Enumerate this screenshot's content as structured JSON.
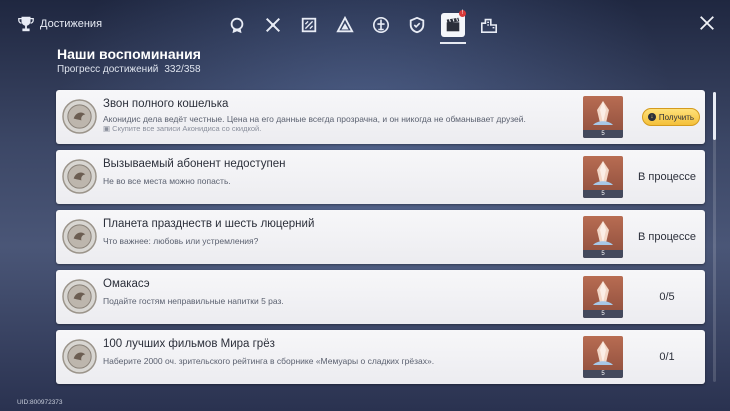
{
  "header": {
    "title": "Достижения",
    "tabs": [
      {
        "icon": "badge-icon"
      },
      {
        "icon": "crossed-swords-icon"
      },
      {
        "icon": "patterned-square-icon"
      },
      {
        "icon": "triangle-emblem-icon"
      },
      {
        "icon": "fountain-emblem-icon"
      },
      {
        "icon": "shield-icon"
      },
      {
        "icon": "film-clapper-icon",
        "active": true,
        "notification": "!"
      },
      {
        "icon": "city-icon"
      }
    ]
  },
  "section": {
    "title": "Наши воспоминания",
    "progress_label": "Прогресс достижений",
    "progress_value": "332/358"
  },
  "achievements": [
    {
      "title": "Звон полного кошелька",
      "description": "Аконидис дела ведёт честные. Цена на его данные всегда прозрачна, и он никогда не обманывает друзей.",
      "hint": "Скупите все записи Аконидиса со скидкой.",
      "reward_count": "5",
      "status": "",
      "claim_label": "Получить"
    },
    {
      "title": "Вызываемый абонент недоступен",
      "description": "Не во все места можно попасть.",
      "reward_count": "5",
      "status": "В процессе"
    },
    {
      "title": "Планета празднеств и шесть люцерний",
      "description": "Что важнее: любовь или устремления?",
      "reward_count": "5",
      "status": "В процессе"
    },
    {
      "title": "Омакасэ",
      "description": "Подайте гостям неправильные напитки 5 раз.",
      "reward_count": "5",
      "status": "0/5"
    },
    {
      "title": "100 лучших фильмов Мира грёз",
      "description": "Наберите 2000 оч. зрительского рейтинга в сборнике «Мемуары о сладких грёзах».",
      "reward_count": "5",
      "status": "0/1"
    }
  ],
  "footer": {
    "uid": "UID:800972373"
  },
  "colors": {
    "accent_gold": "#f4c03a",
    "reward_bg": "#a35d48",
    "notification": "#d93b3b"
  }
}
